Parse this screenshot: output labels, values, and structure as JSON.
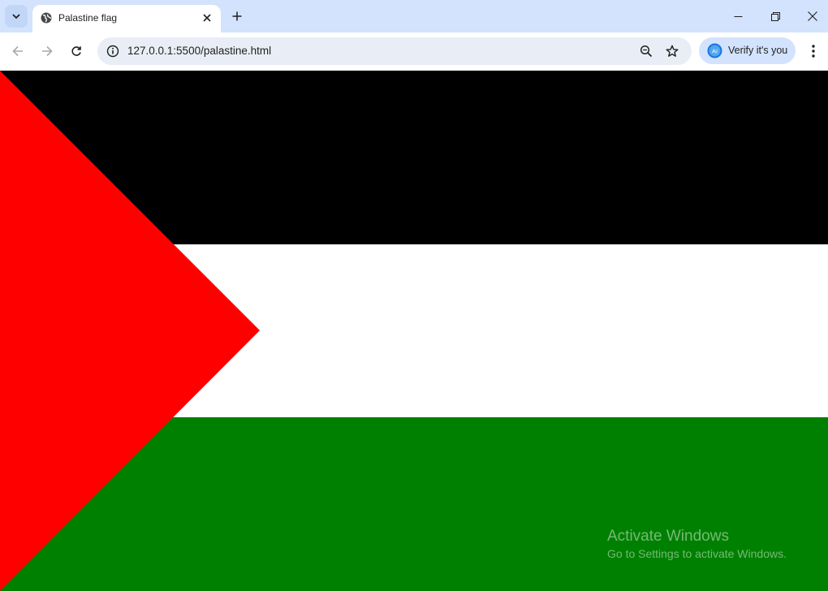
{
  "browser": {
    "tab": {
      "title": "Palastine flag"
    },
    "address_bar": {
      "url": "127.0.0.1:5500/palastine.html"
    },
    "profile_chip": {
      "label": "Verify it's you",
      "avatar_text": "AI"
    }
  },
  "page": {
    "flag": {
      "colors": {
        "top": "#000000",
        "middle": "#ffffff",
        "bottom": "#008000",
        "triangle": "#ff0000"
      }
    }
  },
  "watermark": {
    "title": "Activate Windows",
    "subtitle": "Go to Settings to activate Windows."
  },
  "icons": [
    "tab-search-icon",
    "globe-icon",
    "close-icon",
    "plus-icon",
    "minimize-icon",
    "restore-icon",
    "window-close-icon",
    "back-arrow-icon",
    "forward-arrow-icon",
    "reload-icon",
    "site-info-icon",
    "zoom-icon",
    "star-icon",
    "avatar-icon",
    "more-vert-icon"
  ]
}
